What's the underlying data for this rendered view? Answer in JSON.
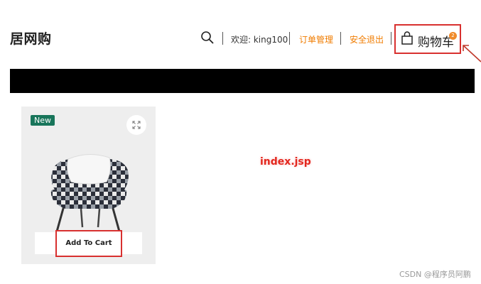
{
  "brand": {
    "title": "居网购"
  },
  "header": {
    "welcome": "欢迎: king100",
    "orders_link": "订单管理",
    "logout_link": "安全退出",
    "cart_label": "购物车",
    "cart_count": "2"
  },
  "product": {
    "badge": "New",
    "add_to_cart": "Add To Cart"
  },
  "annotation": {
    "text": "index.jsp"
  },
  "watermark": {
    "text": "CSDN @程序员阿鹏"
  },
  "colors": {
    "accent": "#f07c00",
    "highlight_border": "#d8302f",
    "new_badge": "#18755a",
    "cart_badge": "#f08a2a"
  },
  "icons": [
    "search-icon",
    "shopping-bag-icon",
    "expand-icon",
    "arrow-icon"
  ]
}
